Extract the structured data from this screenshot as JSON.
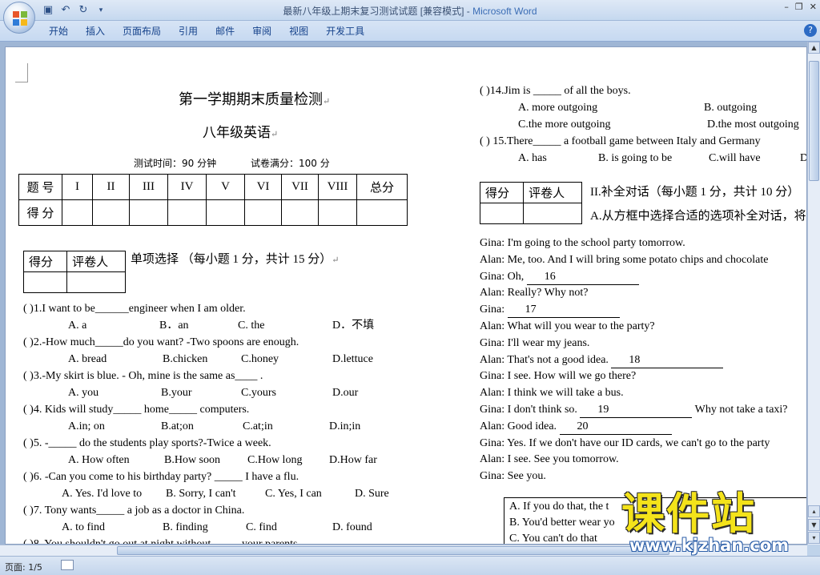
{
  "window": {
    "title_doc": "最新八年级上期末复习测试试题 [兼容模式] - ",
    "title_app": "Microsoft Word"
  },
  "ribbon": {
    "tabs": [
      "开始",
      "插入",
      "页面布局",
      "引用",
      "邮件",
      "审阅",
      "视图",
      "开发工具"
    ]
  },
  "doc": {
    "title": "第一学期期末质量检测",
    "subtitle": "八年级英语",
    "time": "测试时间：90 分钟",
    "full": "试卷满分：100 分",
    "score_header": [
      "题 号",
      "I",
      "II",
      "III",
      "IV",
      "V",
      "VI",
      "VII",
      "VIII",
      "总分"
    ],
    "score_row_label": "得 分",
    "box_headers": [
      "得分",
      "评卷人"
    ],
    "section1": "单项选择 （每小题 1 分，共计 15 分）",
    "q1": "(        )1.I want to be______engineer when I am older.",
    "q1o": [
      "A.      a",
      "B．an",
      "C. the",
      "D．不填"
    ],
    "q2": "(        )2.-How much_____do you want?        -Two spoons are enough.",
    "q2o": [
      "A. bread",
      "B.chicken",
      "C.honey",
      "D.lettuce"
    ],
    "q3": "(        )3.-My skirt is blue.          - Oh, mine is the same as____ .",
    "q3o": [
      "A. you",
      "B.your",
      "C.yours",
      "D.our"
    ],
    "q4": "(        )4.  Kids will study_____ home_____ computers.",
    "q4o": [
      "A.in; on",
      "B.at;on",
      "C.at;in",
      "D.in;in"
    ],
    "q5": "(        )5.  -_____ do the students play sports?-Twice a week.",
    "q5o": [
      "A. How often",
      "B.How soon",
      "C.How long",
      "D.How far"
    ],
    "q6": "(        )6.  -Can you come to his birthday party?        _____ I have a flu.",
    "q6o": [
      "A. Yes. I'd love to",
      "B. Sorry, I can't",
      "C. Yes, I can",
      "D. Sure"
    ],
    "q7": "(        )7. Tony wants_____     a job as a doctor in China.",
    "q7o": [
      "A. to find",
      "B. finding",
      "C. find",
      "D. found"
    ],
    "q8": "(        )8.  You shouldn't go out at night without_____ your parents.",
    "q14": "(        )14.Jim is      _____ of all the boys.",
    "q14o": [
      "A. more outgoing",
      "B. outgoing",
      "C.the more outgoing",
      "D.the most outgoing"
    ],
    "q15": "(        ) 15.There_____ a football game between Italy and Germany",
    "q15o": [
      "A.     has",
      "B. is going to be",
      "C.will have",
      "D"
    ],
    "section2": "II.补全对话（每小题 1 分，共计 10 分）",
    "section2a": "A.从方框中选择合适的选项补全对话，将",
    "dialog": [
      {
        "s": "Gina:",
        "t": "I'm going to the school party tomorrow."
      },
      {
        "s": "Alan:",
        "t": "Me, too. And I will bring some potato chips and chocolate"
      },
      {
        "s": "Gina:",
        "t": "Oh,",
        "blank": "16"
      },
      {
        "s": "Alan:",
        "t": "Really? Why not?"
      },
      {
        "s": "Gina:",
        "t": "",
        "blank": "17"
      },
      {
        "s": "Alan:",
        "t": "What will you wear to the party?"
      },
      {
        "s": "Gina:",
        "t": "I'll wear my jeans."
      },
      {
        "s": "Alan:",
        "t": "That's not a good idea.",
        "blank": "18"
      },
      {
        "s": "Gina:",
        "t": "I see. How will we go there?"
      },
      {
        "s": "Alan:",
        "t": "I think we will take a bus."
      },
      {
        "s": "Gina:",
        "t": "I don't think so.",
        "blank": "19",
        "after": "Why not take a taxi?"
      },
      {
        "s": "Alan:",
        "t": "Good idea.",
        "blank": "20"
      },
      {
        "s": "Gina:",
        "t": "Yes. If we don't have our ID cards, we can't go to the party"
      },
      {
        "s": "Alan:",
        "t": "I see. See you tomorrow."
      },
      {
        "s": "Gina:",
        "t": "See you."
      }
    ],
    "options": [
      "A. If you do that, the t",
      "B. You'd better wear yo",
      "C. You can't do that"
    ]
  },
  "status": {
    "page": "页面: 1/5"
  },
  "watermark": {
    "main": "课件站",
    "url": "www.kjzhan.com"
  }
}
